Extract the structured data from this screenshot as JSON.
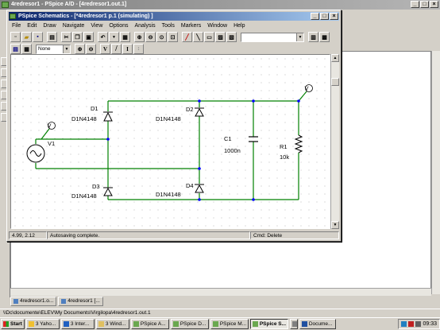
{
  "outer_window": {
    "title": "4redresor1 - PSpice A/D - [4redresor1.out.1]",
    "doc_tabs": [
      "4redresor1.o...",
      "4redresor1 [..."
    ],
    "path": "\\\\Dc\\documente\\ELEV\\My Documents\\Virgilopa\\4redresor1.out.1"
  },
  "schematics": {
    "title": "PSpice Schematics - [*4redresor1  p.1 (simulating) ]",
    "menu": [
      "File",
      "Edit",
      "Draw",
      "Navigate",
      "View",
      "Options",
      "Analysis",
      "Tools",
      "Markers",
      "Window",
      "Help"
    ],
    "filter_value": "None",
    "status": {
      "coords": "4.99, 2.12",
      "message": "Autosaving complete.",
      "cmd": "Cmd: Delete"
    },
    "components": {
      "d1_ref": "D1",
      "d1_model": "D1N4148",
      "d2_ref": "D2",
      "d2_model": "D1N4148",
      "d3_ref": "D3",
      "d3_model": "D1N4148",
      "d4_ref": "D4",
      "d4_model": "D1N4148",
      "v1_ref": "V1",
      "c1_ref": "C1",
      "c1_value": "1000n",
      "r1_ref": "R1",
      "r1_value": "10k",
      "probe_label": "V"
    }
  },
  "taskbar": {
    "start": "Start",
    "tasks": [
      "3 Yaho...",
      "3 Inter...",
      "3 Wind...",
      "PSpice A...",
      "PSpice D...",
      "PSpice M...",
      "PSpice S...",
      "Docume..."
    ],
    "clock": "09:33"
  },
  "colors": {
    "wire": "#008000",
    "junction": "#0000ff",
    "component": "#000000"
  }
}
